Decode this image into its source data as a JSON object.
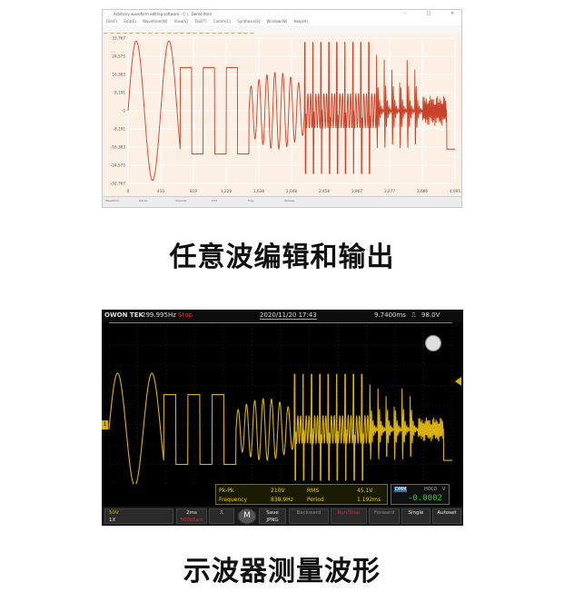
{
  "editor": {
    "title": "Arbitrary waveform editing software - C:\\...Demo.html",
    "window_controls": [
      "–",
      "□",
      "×"
    ],
    "menu": [
      "File(F)",
      "Edit(E)",
      "Waveform(W)",
      "View(V)",
      "Tool(T)",
      "Comm(C)",
      "Synthesis(S)",
      "Window(W)",
      "Help(H)"
    ],
    "y_ticks": [
      "32,767",
      "24,575",
      "16,383",
      "8,191",
      "0",
      "-8,191",
      "-16,383",
      "-24,575",
      "-32,767"
    ],
    "x_ticks": [
      "0",
      "410",
      "819",
      "1,229",
      "1,638",
      "2,048",
      "2,458",
      "2,867",
      "3,277",
      "3,686",
      "4,095"
    ],
    "footer_items": [
      "Waveform",
      "Points",
      "Channel",
      "CH1",
      "Freq",
      "Sample"
    ],
    "colors": {
      "background": "#fbf0e3",
      "trace": "#c9432a",
      "grid": "#ffffff"
    }
  },
  "captions": {
    "top": "任意波编辑和输出",
    "bottom": "示波器测量波形"
  },
  "scope": {
    "brand": "OWON TEK",
    "frequency": "299.995Hz",
    "state": "Stop",
    "datetime": "2020/11/20  17:43",
    "timebase_offset": "9.7400ms",
    "trigger_level": "98.0V",
    "channel_marker": "1",
    "measurements": [
      {
        "label": "Pk-Pk",
        "value": "210V"
      },
      {
        "label": "Frequency",
        "value": "838.9Hz"
      },
      {
        "label": "RMS",
        "value": "45.1V"
      },
      {
        "label": "Period",
        "value": "1.192ms"
      }
    ],
    "dmm": {
      "mode": "DMM",
      "hold": "HOLD",
      "unit": "V",
      "reading": "-0.0002"
    },
    "footer": {
      "ch1_volt": "50V",
      "ch1_probe": "1X",
      "time": "2ms",
      "sample_rate": "500kSa/s",
      "menu_label": "M",
      "save_label": "Save\nJPNG",
      "backward": "Backward",
      "runstop": "Run/Stop",
      "forward": "Forward",
      "single": "Single",
      "autoset": "Autoset"
    },
    "colors": {
      "trace": "#d8b010",
      "background": "#000000",
      "grid": "#2e2e2e",
      "stop": "#e03030"
    }
  }
}
